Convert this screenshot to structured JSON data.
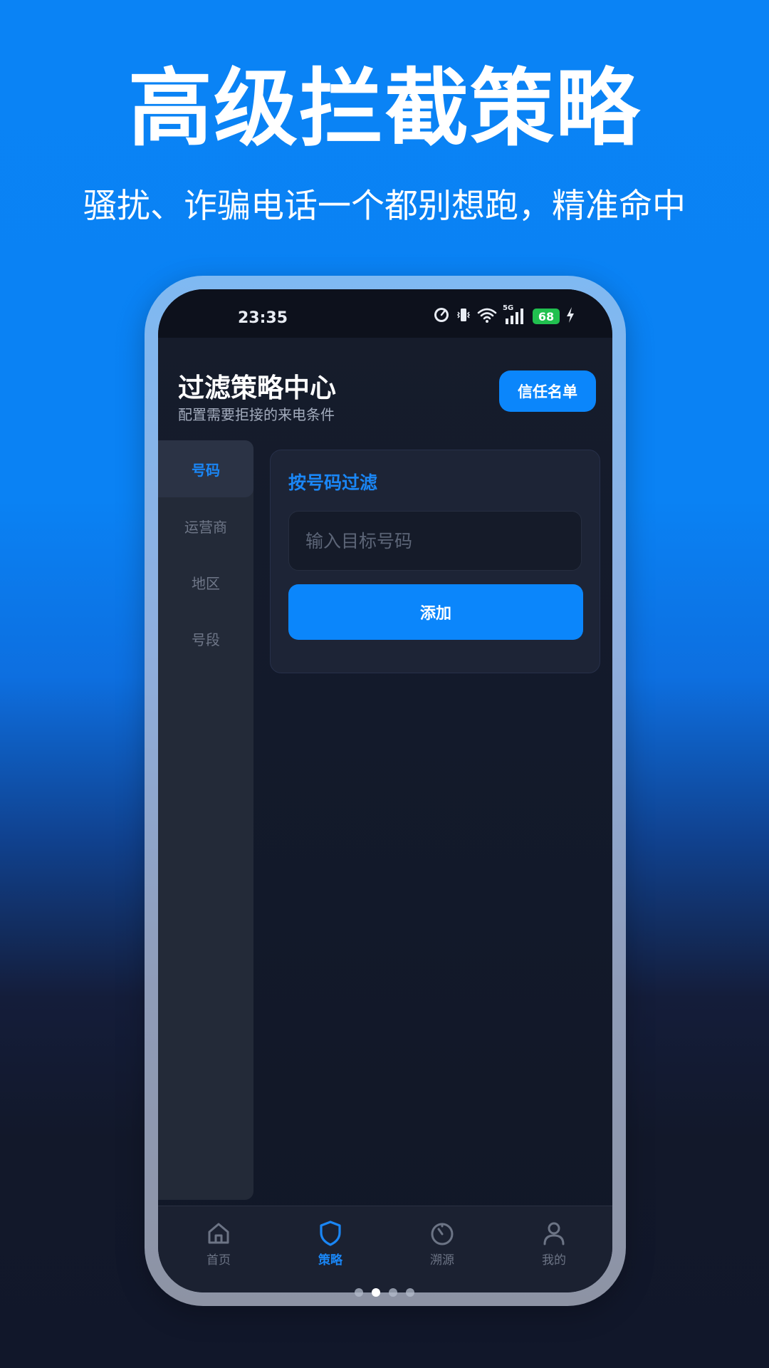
{
  "promo": {
    "title": "高级拦截策略",
    "subtitle": "骚扰、诈骗电话一个都别想跑，精准命中"
  },
  "statusbar": {
    "time": "23:35",
    "network": "5G",
    "battery": "68",
    "icons": [
      "gauge-icon",
      "vibrate-icon",
      "wifi-icon",
      "signal-icon",
      "battery-icon",
      "charging-icon"
    ]
  },
  "header": {
    "title": "过滤策略中心",
    "subtitle": "配置需要拒接的来电条件",
    "trust_button": "信任名单"
  },
  "sidebar": {
    "items": [
      {
        "label": "号码",
        "active": true
      },
      {
        "label": "运营商",
        "active": false
      },
      {
        "label": "地区",
        "active": false
      },
      {
        "label": "号段",
        "active": false
      }
    ]
  },
  "card": {
    "title": "按号码过滤",
    "input_placeholder": "输入目标号码",
    "input_value": "",
    "add_button": "添加"
  },
  "bottom_nav": {
    "items": [
      {
        "label": "首页",
        "icon": "home-icon",
        "active": false
      },
      {
        "label": "策略",
        "icon": "shield-icon",
        "active": true
      },
      {
        "label": "溯源",
        "icon": "timer-icon",
        "active": false
      },
      {
        "label": "我的",
        "icon": "user-icon",
        "active": false
      }
    ]
  },
  "pager": {
    "page_count": 4,
    "current_page": 2
  },
  "colors": {
    "accent": "#0b86fb",
    "background_top": "#0a83f5",
    "background_bottom": "#11172a",
    "screen_bg": "#131a2b",
    "battery": "#21c04f"
  }
}
